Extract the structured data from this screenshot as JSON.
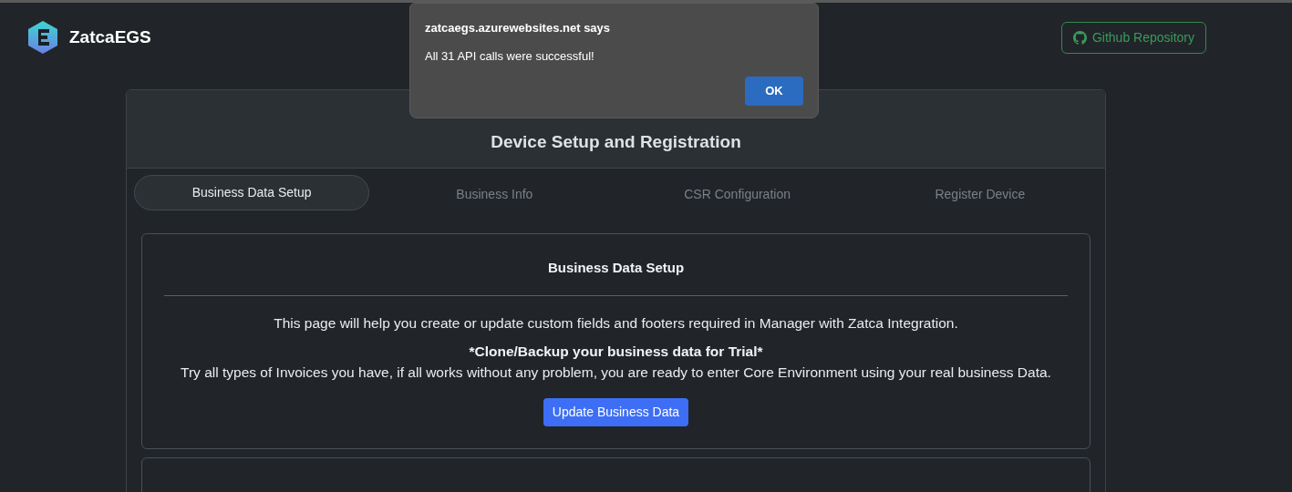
{
  "brand": {
    "name": "ZatcaEGS"
  },
  "github_button": {
    "label": "Github Repository"
  },
  "card": {
    "subtitle": "Device Setup and Registration"
  },
  "tabs": [
    {
      "label": "Business Data Setup",
      "selected": true
    },
    {
      "label": "Business Info",
      "selected": false
    },
    {
      "label": "CSR Configuration",
      "selected": false
    },
    {
      "label": "Register Device",
      "selected": false
    }
  ],
  "section": {
    "title": "Business Data Setup",
    "intro": "This page will help you create or update custom fields and footers required in Manager with Zatca Integration.",
    "emphasis": "*Clone/Backup your business data for Trial*",
    "note": "Try all types of Invoices you have, if all works without any problem, you are ready to enter Core Environment using your real business Data.",
    "button": "Update Business Data"
  },
  "dialog": {
    "title": "zatcaegs.azurewebsites.net says",
    "message": "All 31 API calls were successful!",
    "button": "OK"
  }
}
